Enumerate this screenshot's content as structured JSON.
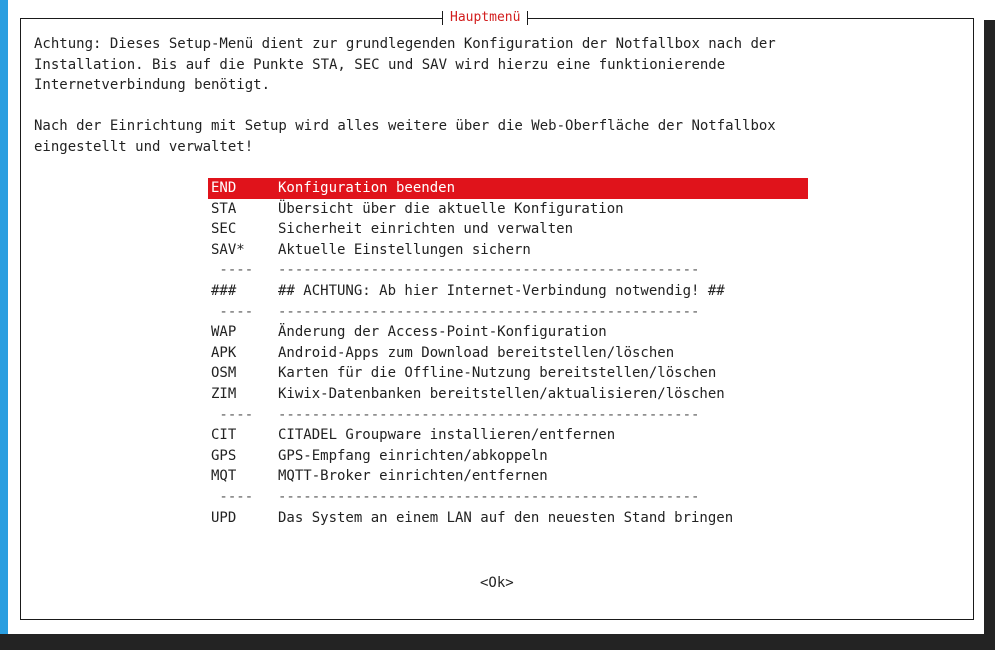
{
  "dialog": {
    "title": "Hauptmenü",
    "intro": "Achtung: Dieses Setup-Menü dient zur grundlegenden Konfiguration der Notfallbox nach der\nInstallation. Bis auf die Punkte STA, SEC und SAV wird hierzu eine funktionierende\nInternetverbindung benötigt.\n\nNach der Einrichtung mit Setup wird alles weitere über die Web-Oberfläche der Notfallbox\neingestellt und verwaltet!",
    "ok_label": "<Ok>"
  },
  "menu": {
    "items": [
      {
        "tag": "END",
        "desc": "Konfiguration beenden",
        "selected": true
      },
      {
        "tag": "STA",
        "desc": "Übersicht über die aktuelle Konfiguration"
      },
      {
        "tag": "SEC",
        "desc": "Sicherheit einrichten und verwalten"
      },
      {
        "tag": "SAV*",
        "desc": "Aktuelle Einstellungen sichern"
      },
      {
        "tag": " ----",
        "desc": "--------------------------------------------------",
        "separator": true
      },
      {
        "tag": "###",
        "desc": "## ACHTUNG: Ab hier Internet-Verbindung notwendig! ##"
      },
      {
        "tag": " ----",
        "desc": "--------------------------------------------------",
        "separator": true
      },
      {
        "tag": "WAP",
        "desc": "Änderung der Access-Point-Konfiguration"
      },
      {
        "tag": "APK",
        "desc": "Android-Apps zum Download bereitstellen/löschen"
      },
      {
        "tag": "OSM",
        "desc": "Karten für die Offline-Nutzung bereitstellen/löschen"
      },
      {
        "tag": "ZIM",
        "desc": "Kiwix-Datenbanken bereitstellen/aktualisieren/löschen"
      },
      {
        "tag": " ----",
        "desc": "--------------------------------------------------",
        "separator": true
      },
      {
        "tag": "CIT",
        "desc": "CITADEL Groupware installieren/entfernen"
      },
      {
        "tag": "GPS",
        "desc": "GPS-Empfang einrichten/abkoppeln"
      },
      {
        "tag": "MQT",
        "desc": "MQTT-Broker einrichten/entfernen"
      },
      {
        "tag": " ----",
        "desc": "--------------------------------------------------",
        "separator": true
      },
      {
        "tag": "UPD",
        "desc": "Das System an einem LAN auf den neuesten Stand bringen"
      }
    ]
  },
  "colors": {
    "highlight": "#e0131b",
    "title": "#d21d1d",
    "terminal_accent": "#2a9ee0"
  }
}
